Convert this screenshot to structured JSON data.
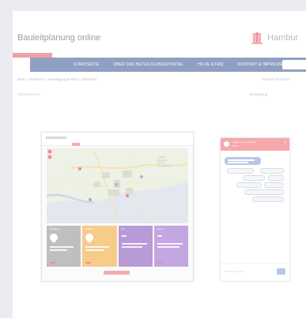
{
  "site": {
    "title": "Bauleitplanung online",
    "brand_name": "Hambur"
  },
  "nav": {
    "items": [
      {
        "label": "STARTSEITE"
      },
      {
        "label": "ÜBER DAS BETEILIGUNGSPORTAL"
      },
      {
        "label": "HILFE & FAQ"
      },
      {
        "label": "KONTAKT & IMPRESSUM"
      }
    ]
  },
  "breadcrumb": "Start > Verfahren > Beteiligung B-Plan > Übersicht",
  "top_link": "Weitere Verfahren",
  "sub_left": "Verfahrensinfo",
  "sub_right": "Beteiligung",
  "preview": {
    "legend": [
      "Verfahren",
      "Beteiligung",
      "Planung",
      "Abgeschlossen"
    ],
    "cards": [
      {
        "title": "Beteiligung",
        "color": "#bfbfbf"
      },
      {
        "title": "Planung",
        "color": "#f7cb8a"
      },
      {
        "title": "Info",
        "color": "#b79bd6"
      },
      {
        "title": "Termine",
        "color": "#c4a6e2"
      }
    ]
  },
  "chat": {
    "title": "Fragen zum Verfahren",
    "subtitle": "Chatbot",
    "close": "×",
    "input_placeholder": "Nachricht eingeben..."
  },
  "colors": {
    "nav_bg": "#8fa0c2",
    "accent": "#f1a1a9",
    "chat_header": "#f5a9ad",
    "bubble": "#b7c7e8"
  }
}
